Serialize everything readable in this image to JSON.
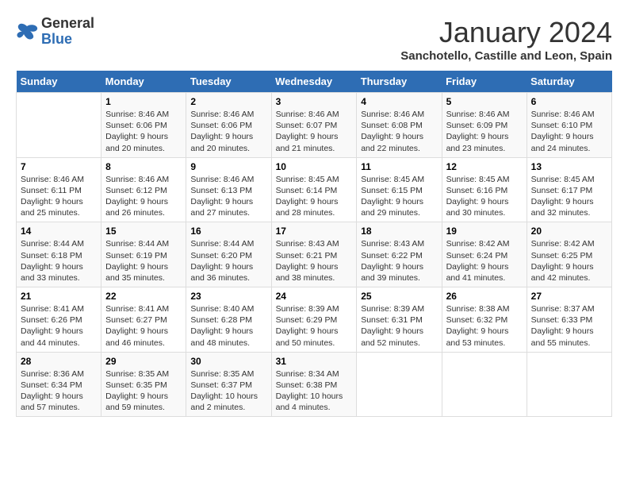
{
  "logo": {
    "general": "General",
    "blue": "Blue"
  },
  "header": {
    "title": "January 2024",
    "subtitle": "Sanchotello, Castille and Leon, Spain"
  },
  "weekdays": [
    "Sunday",
    "Monday",
    "Tuesday",
    "Wednesday",
    "Thursday",
    "Friday",
    "Saturday"
  ],
  "weeks": [
    [
      {
        "day": "",
        "content": ""
      },
      {
        "day": "1",
        "content": "Sunrise: 8:46 AM\nSunset: 6:06 PM\nDaylight: 9 hours\nand 20 minutes."
      },
      {
        "day": "2",
        "content": "Sunrise: 8:46 AM\nSunset: 6:06 PM\nDaylight: 9 hours\nand 20 minutes."
      },
      {
        "day": "3",
        "content": "Sunrise: 8:46 AM\nSunset: 6:07 PM\nDaylight: 9 hours\nand 21 minutes."
      },
      {
        "day": "4",
        "content": "Sunrise: 8:46 AM\nSunset: 6:08 PM\nDaylight: 9 hours\nand 22 minutes."
      },
      {
        "day": "5",
        "content": "Sunrise: 8:46 AM\nSunset: 6:09 PM\nDaylight: 9 hours\nand 23 minutes."
      },
      {
        "day": "6",
        "content": "Sunrise: 8:46 AM\nSunset: 6:10 PM\nDaylight: 9 hours\nand 24 minutes."
      }
    ],
    [
      {
        "day": "7",
        "content": "Sunrise: 8:46 AM\nSunset: 6:11 PM\nDaylight: 9 hours\nand 25 minutes."
      },
      {
        "day": "8",
        "content": "Sunrise: 8:46 AM\nSunset: 6:12 PM\nDaylight: 9 hours\nand 26 minutes."
      },
      {
        "day": "9",
        "content": "Sunrise: 8:46 AM\nSunset: 6:13 PM\nDaylight: 9 hours\nand 27 minutes."
      },
      {
        "day": "10",
        "content": "Sunrise: 8:45 AM\nSunset: 6:14 PM\nDaylight: 9 hours\nand 28 minutes."
      },
      {
        "day": "11",
        "content": "Sunrise: 8:45 AM\nSunset: 6:15 PM\nDaylight: 9 hours\nand 29 minutes."
      },
      {
        "day": "12",
        "content": "Sunrise: 8:45 AM\nSunset: 6:16 PM\nDaylight: 9 hours\nand 30 minutes."
      },
      {
        "day": "13",
        "content": "Sunrise: 8:45 AM\nSunset: 6:17 PM\nDaylight: 9 hours\nand 32 minutes."
      }
    ],
    [
      {
        "day": "14",
        "content": "Sunrise: 8:44 AM\nSunset: 6:18 PM\nDaylight: 9 hours\nand 33 minutes."
      },
      {
        "day": "15",
        "content": "Sunrise: 8:44 AM\nSunset: 6:19 PM\nDaylight: 9 hours\nand 35 minutes."
      },
      {
        "day": "16",
        "content": "Sunrise: 8:44 AM\nSunset: 6:20 PM\nDaylight: 9 hours\nand 36 minutes."
      },
      {
        "day": "17",
        "content": "Sunrise: 8:43 AM\nSunset: 6:21 PM\nDaylight: 9 hours\nand 38 minutes."
      },
      {
        "day": "18",
        "content": "Sunrise: 8:43 AM\nSunset: 6:22 PM\nDaylight: 9 hours\nand 39 minutes."
      },
      {
        "day": "19",
        "content": "Sunrise: 8:42 AM\nSunset: 6:24 PM\nDaylight: 9 hours\nand 41 minutes."
      },
      {
        "day": "20",
        "content": "Sunrise: 8:42 AM\nSunset: 6:25 PM\nDaylight: 9 hours\nand 42 minutes."
      }
    ],
    [
      {
        "day": "21",
        "content": "Sunrise: 8:41 AM\nSunset: 6:26 PM\nDaylight: 9 hours\nand 44 minutes."
      },
      {
        "day": "22",
        "content": "Sunrise: 8:41 AM\nSunset: 6:27 PM\nDaylight: 9 hours\nand 46 minutes."
      },
      {
        "day": "23",
        "content": "Sunrise: 8:40 AM\nSunset: 6:28 PM\nDaylight: 9 hours\nand 48 minutes."
      },
      {
        "day": "24",
        "content": "Sunrise: 8:39 AM\nSunset: 6:29 PM\nDaylight: 9 hours\nand 50 minutes."
      },
      {
        "day": "25",
        "content": "Sunrise: 8:39 AM\nSunset: 6:31 PM\nDaylight: 9 hours\nand 52 minutes."
      },
      {
        "day": "26",
        "content": "Sunrise: 8:38 AM\nSunset: 6:32 PM\nDaylight: 9 hours\nand 53 minutes."
      },
      {
        "day": "27",
        "content": "Sunrise: 8:37 AM\nSunset: 6:33 PM\nDaylight: 9 hours\nand 55 minutes."
      }
    ],
    [
      {
        "day": "28",
        "content": "Sunrise: 8:36 AM\nSunset: 6:34 PM\nDaylight: 9 hours\nand 57 minutes."
      },
      {
        "day": "29",
        "content": "Sunrise: 8:35 AM\nSunset: 6:35 PM\nDaylight: 9 hours\nand 59 minutes."
      },
      {
        "day": "30",
        "content": "Sunrise: 8:35 AM\nSunset: 6:37 PM\nDaylight: 10 hours\nand 2 minutes."
      },
      {
        "day": "31",
        "content": "Sunrise: 8:34 AM\nSunset: 6:38 PM\nDaylight: 10 hours\nand 4 minutes."
      },
      {
        "day": "",
        "content": ""
      },
      {
        "day": "",
        "content": ""
      },
      {
        "day": "",
        "content": ""
      }
    ]
  ]
}
